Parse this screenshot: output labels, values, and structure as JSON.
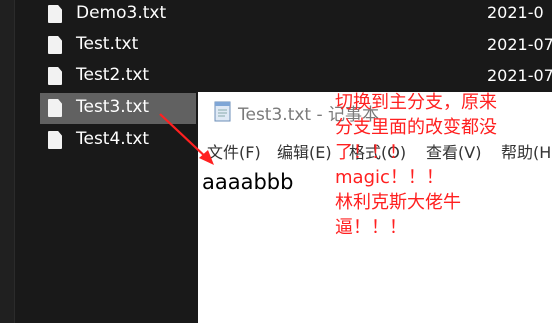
{
  "explorer": {
    "files": [
      {
        "name": "Demo3.txt",
        "date": "2021-0"
      },
      {
        "name": "Test.txt",
        "date": "2021-07"
      },
      {
        "name": "Test2.txt",
        "date": "2021-07"
      },
      {
        "name": "Test3.txt",
        "date": "",
        "selected": true
      },
      {
        "name": "Test4.txt",
        "date": ""
      }
    ]
  },
  "notepad": {
    "title": "Test3.txt - 记事本",
    "menu": [
      "文件(F)",
      "编辑(E)",
      "格式(O)",
      "查看(V)",
      "帮助(H"
    ],
    "content": "aaaabbb"
  },
  "annotation": {
    "lines": [
      "切换到主分支，原来",
      "分支里面的改变都没",
      "了！！！",
      "magic！！！",
      "林利克斯大佬牛",
      "逼！！！"
    ],
    "color": "#ff2020"
  },
  "colors": {
    "background": "#191919",
    "selection": "#616161",
    "arrow": "#ff2020"
  }
}
